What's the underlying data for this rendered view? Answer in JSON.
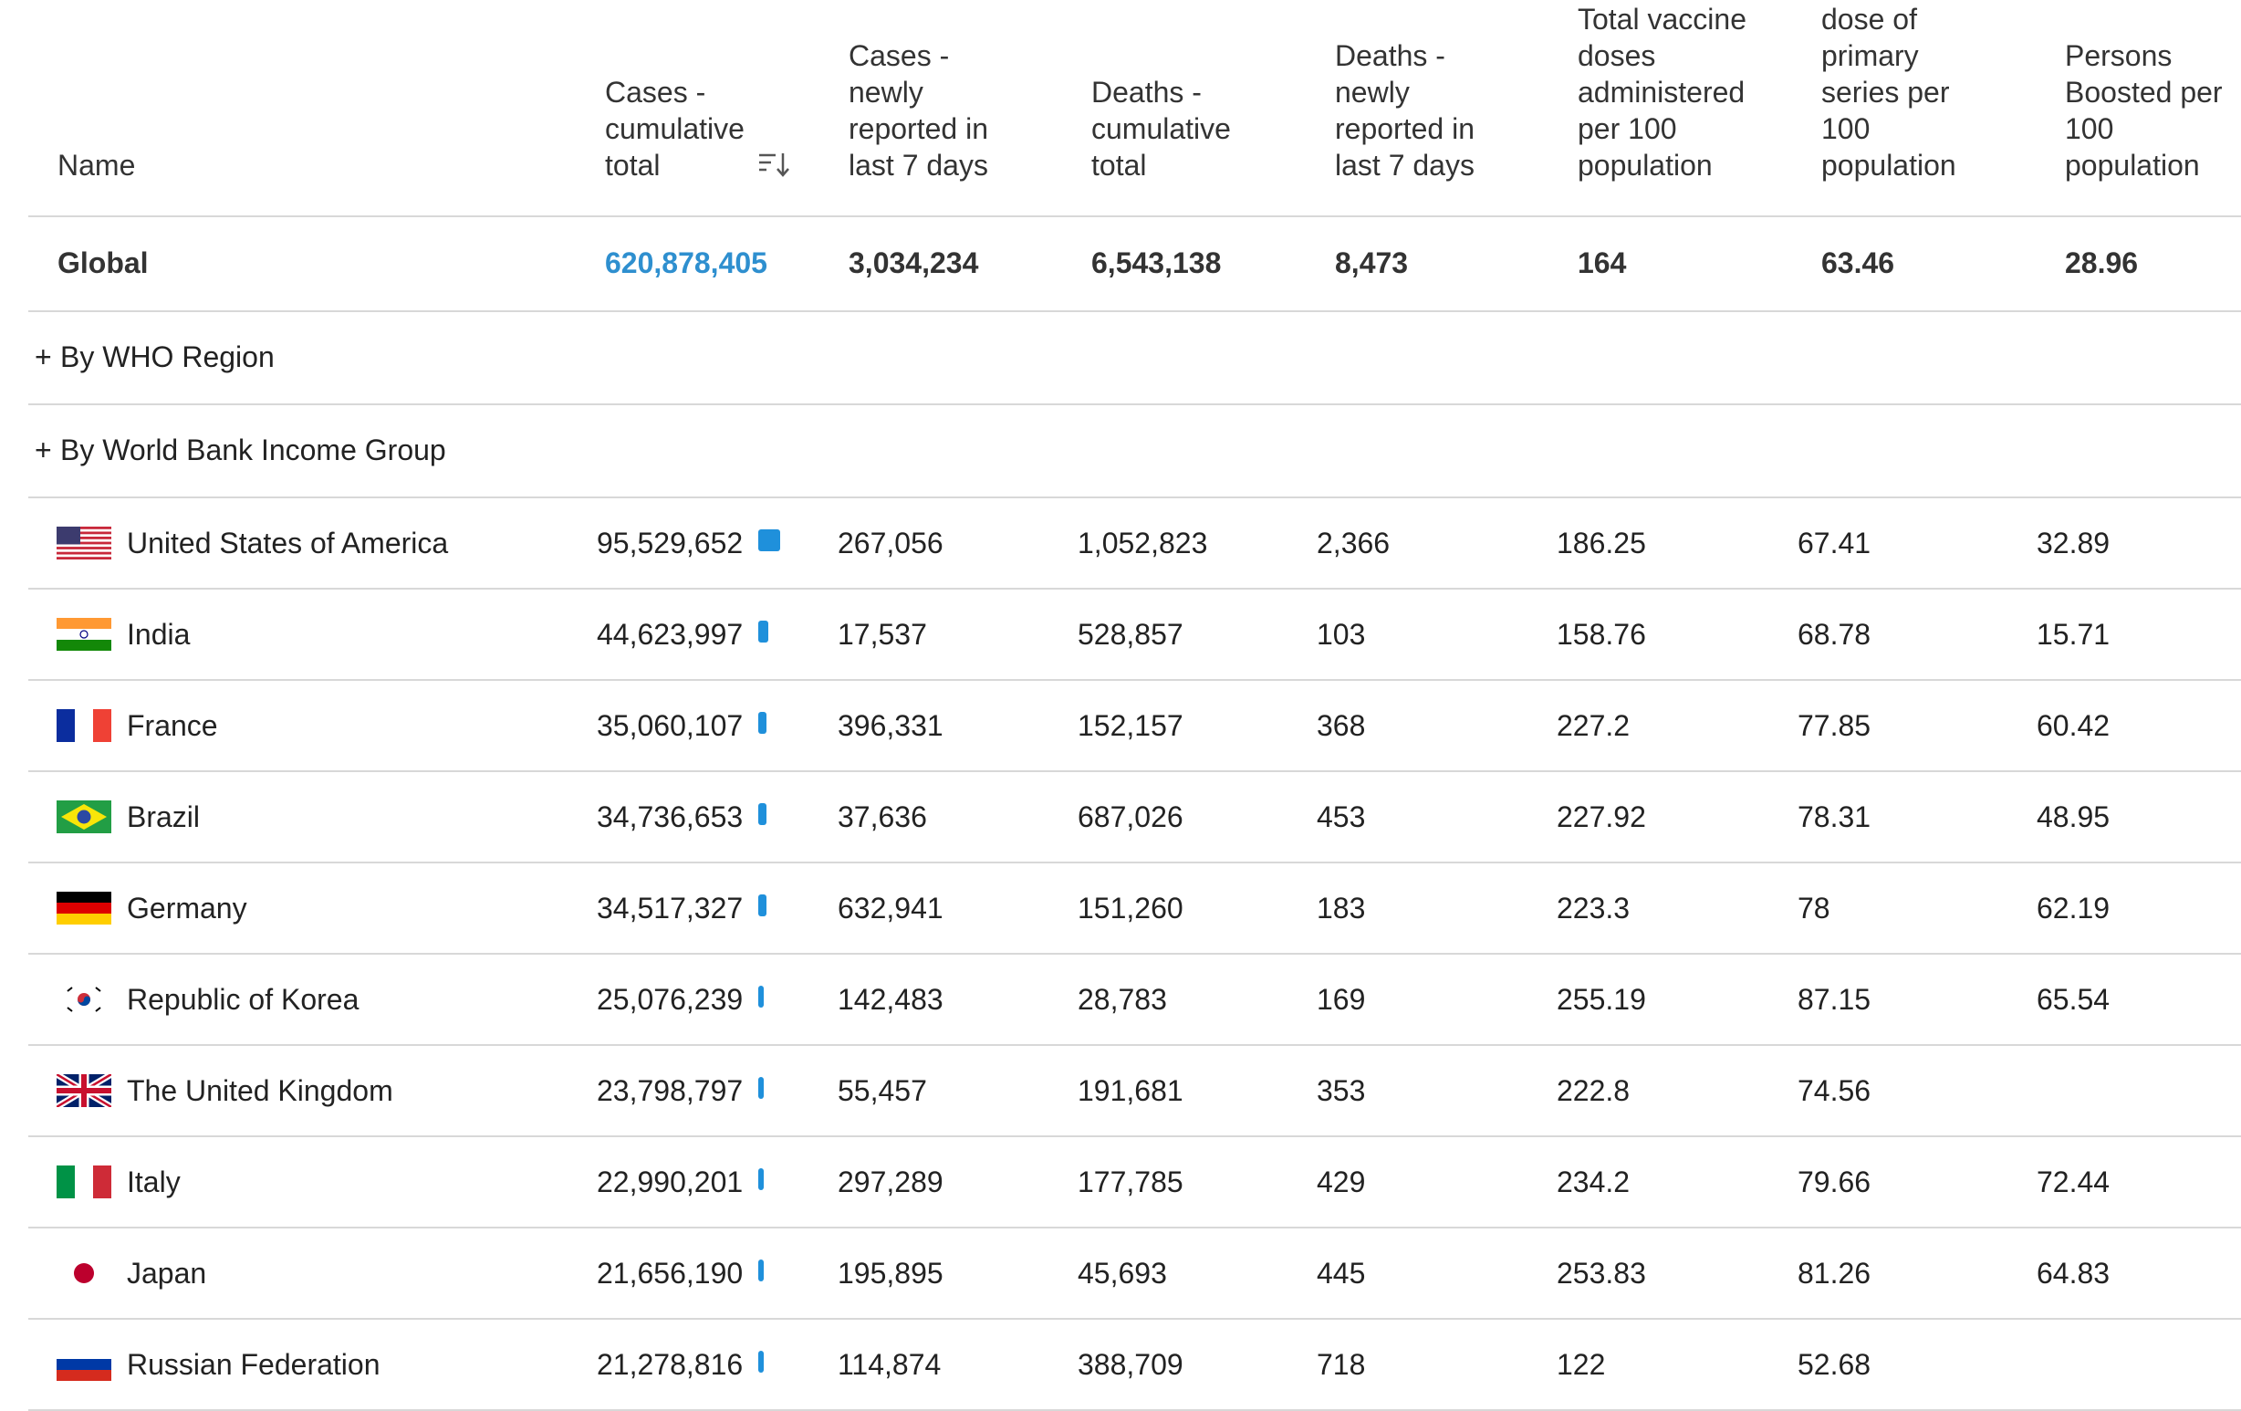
{
  "columns": {
    "name": "Name",
    "cases_cumulative": "Cases -\ncumulative\ntotal",
    "cases_7d": "Cases -\nnewly\nreported in\nlast 7 days",
    "deaths_cumulative": "Deaths -\ncumulative\ntotal",
    "deaths_7d": "Deaths -\nnewly\nreported in\nlast 7 days",
    "vaccine_doses": "Total vaccine\ndoses\nadministered\nper 100\npopulation",
    "primary_series": "dose of\nprimary\nseries per\n100\npopulation",
    "boosted": "Persons\nBoosted per\n100\npopulation"
  },
  "sort_icon": "sort-descending-icon",
  "global": {
    "name": "Global",
    "cases_cumulative": "620,878,405",
    "cases_7d": "3,034,234",
    "deaths_cumulative": "6,543,138",
    "deaths_7d": "8,473",
    "vaccine_doses": "164",
    "primary_series": "63.46",
    "boosted": "28.96"
  },
  "groups": [
    {
      "plus": "+",
      "label": "By WHO Region"
    },
    {
      "plus": "+",
      "label": "By World Bank Income Group"
    }
  ],
  "bar_color": "#1f90db",
  "link_color": "#2e8fcf",
  "rows": [
    {
      "flag": "us-flag-icon",
      "name": "United States of America",
      "cases_cumulative": "95,529,652",
      "cases_share": 0.154,
      "cases_7d": "267,056",
      "deaths_cumulative": "1,052,823",
      "deaths_7d": "2,366",
      "vaccine_doses": "186.25",
      "primary_series": "67.41",
      "boosted": "32.89"
    },
    {
      "flag": "india-flag-icon",
      "name": "India",
      "cases_cumulative": "44,623,997",
      "cases_share": 0.072,
      "cases_7d": "17,537",
      "deaths_cumulative": "528,857",
      "deaths_7d": "103",
      "vaccine_doses": "158.76",
      "primary_series": "68.78",
      "boosted": "15.71"
    },
    {
      "flag": "france-flag-icon",
      "name": "France",
      "cases_cumulative": "35,060,107",
      "cases_share": 0.056,
      "cases_7d": "396,331",
      "deaths_cumulative": "152,157",
      "deaths_7d": "368",
      "vaccine_doses": "227.2",
      "primary_series": "77.85",
      "boosted": "60.42"
    },
    {
      "flag": "brazil-flag-icon",
      "name": "Brazil",
      "cases_cumulative": "34,736,653",
      "cases_share": 0.056,
      "cases_7d": "37,636",
      "deaths_cumulative": "687,026",
      "deaths_7d": "453",
      "vaccine_doses": "227.92",
      "primary_series": "78.31",
      "boosted": "48.95"
    },
    {
      "flag": "germany-flag-icon",
      "name": "Germany",
      "cases_cumulative": "34,517,327",
      "cases_share": 0.056,
      "cases_7d": "632,941",
      "deaths_cumulative": "151,260",
      "deaths_7d": "183",
      "vaccine_doses": "223.3",
      "primary_series": "78",
      "boosted": "62.19"
    },
    {
      "flag": "korea-flag-icon",
      "name": "Republic of Korea",
      "cases_cumulative": "25,076,239",
      "cases_share": 0.04,
      "cases_7d": "142,483",
      "deaths_cumulative": "28,783",
      "deaths_7d": "169",
      "vaccine_doses": "255.19",
      "primary_series": "87.15",
      "boosted": "65.54"
    },
    {
      "flag": "uk-flag-icon",
      "name": "The United Kingdom",
      "cases_cumulative": "23,798,797",
      "cases_share": 0.038,
      "cases_7d": "55,457",
      "deaths_cumulative": "191,681",
      "deaths_7d": "353",
      "vaccine_doses": "222.8",
      "primary_series": "74.56",
      "boosted": ""
    },
    {
      "flag": "italy-flag-icon",
      "name": "Italy",
      "cases_cumulative": "22,990,201",
      "cases_share": 0.037,
      "cases_7d": "297,289",
      "deaths_cumulative": "177,785",
      "deaths_7d": "429",
      "vaccine_doses": "234.2",
      "primary_series": "79.66",
      "boosted": "72.44"
    },
    {
      "flag": "japan-flag-icon",
      "name": "Japan",
      "cases_cumulative": "21,656,190",
      "cases_share": 0.035,
      "cases_7d": "195,895",
      "deaths_cumulative": "45,693",
      "deaths_7d": "445",
      "vaccine_doses": "253.83",
      "primary_series": "81.26",
      "boosted": "64.83"
    },
    {
      "flag": "russia-flag-icon",
      "name": "Russian Federation",
      "cases_cumulative": "21,278,816",
      "cases_share": 0.034,
      "cases_7d": "114,874",
      "deaths_cumulative": "388,709",
      "deaths_7d": "718",
      "vaccine_doses": "122",
      "primary_series": "52.68",
      "boosted": ""
    }
  ]
}
